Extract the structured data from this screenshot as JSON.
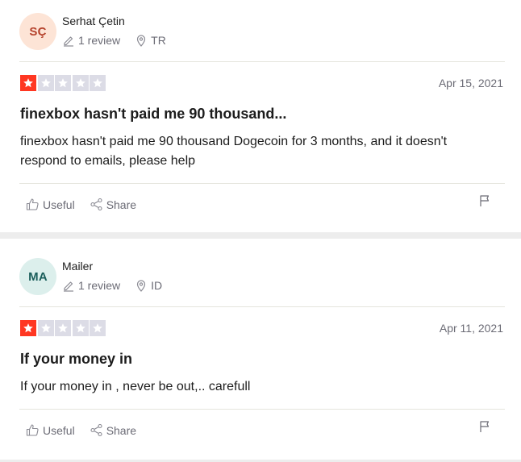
{
  "reviews": [
    {
      "avatar_initials": "SÇ",
      "avatar_bg": "#fde4d6",
      "avatar_color": "#b5422c",
      "name": "Serhat Çetin",
      "review_count": "1 review",
      "country": "TR",
      "rating": 1,
      "date": "Apr 15, 2021",
      "title": "finexbox hasn't paid me 90 thousand...",
      "body": "finexbox hasn't paid me 90 thousand Dogecoin for 3 months, and it doesn't respond to emails, please help",
      "useful_label": "Useful",
      "share_label": "Share"
    },
    {
      "avatar_initials": "MA",
      "avatar_bg": "#dcefec",
      "avatar_color": "#1b5e5b",
      "name": "Mailer",
      "review_count": "1 review",
      "country": "ID",
      "rating": 1,
      "date": "Apr 11, 2021",
      "title": "If your money in",
      "body": "If your money in , never be out,.. carefull",
      "useful_label": "Useful",
      "share_label": "Share"
    }
  ],
  "colors": {
    "star_filled": "#ff3722",
    "star_empty": "#dcdce6"
  }
}
